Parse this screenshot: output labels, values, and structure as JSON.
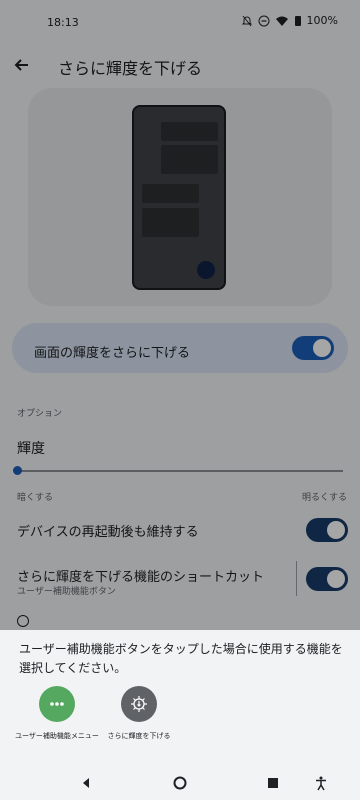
{
  "status": {
    "time": "18:13",
    "battery": "100%"
  },
  "header": {
    "title": "さらに輝度を下げる"
  },
  "main_toggle": {
    "label": "画面の輝度をさらに下げる",
    "checked": true
  },
  "options": {
    "section_label": "オプション",
    "brightness_title": "輝度",
    "slider_left_label": "暗くする",
    "slider_right_label": "明るくする",
    "slider_value": 0.0
  },
  "settings": [
    {
      "label": "デバイスの再起動後も維持する",
      "checked": true
    },
    {
      "label": "さらに輝度を下げる機能のショートカット",
      "sublabel": "ユーザー補助機能ボタン",
      "checked": true
    }
  ],
  "sheet": {
    "message": "ユーザー補助機能ボタンをタップした場合に使用する機能を選択してください。",
    "targets": [
      {
        "label": "ユーザー補助機能メニュー",
        "icon": "more-horiz-icon",
        "color": "#55a85f"
      },
      {
        "label": "さらに輝度を下げる",
        "icon": "dimmer-icon",
        "color": "#5f6368"
      }
    ]
  },
  "nav": {
    "icons": [
      "back-icon",
      "home-icon",
      "recents-icon",
      "accessibility-icon"
    ]
  },
  "colors": {
    "accent": "#1b5eb8",
    "dark_switch": "#173c6b"
  }
}
